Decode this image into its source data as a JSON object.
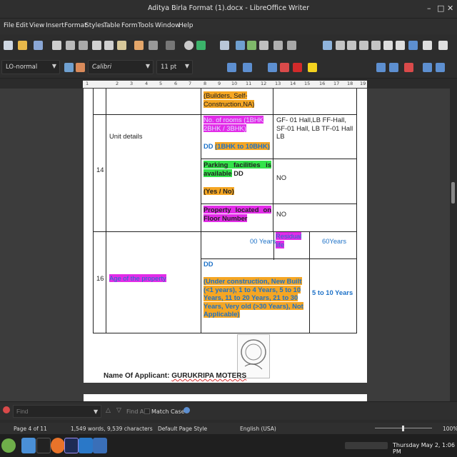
{
  "window": {
    "title": "Aditya Birla Format (1).docx - LibreOffice Writer",
    "minimize": "–",
    "maximize": "□",
    "close": "✕"
  },
  "menu": [
    "File",
    "Edit",
    "View",
    "Insert",
    "Format",
    "Styles",
    "Table",
    "Form",
    "Tools",
    "Window",
    "Help"
  ],
  "toolbar": {
    "paragraph_style": "LO-normal",
    "font_name": "Calibri",
    "font_size": "11 pt"
  },
  "ruler": [
    "1",
    "2",
    "3",
    "4",
    "5",
    "6",
    "7",
    "8",
    "9",
    "10",
    "11",
    "12",
    "13",
    "14",
    "15",
    "16",
    "17",
    "18",
    "19"
  ],
  "document": {
    "r0_col3": "(Builders, Self-Construction,NA)",
    "r14_no": "14",
    "r14_label": "Unit details",
    "r14_rooms_label": "No. of rooms (1BHK 2BHK / 3BHK)",
    "r14_rooms_dd": "DD",
    "r14_rooms_range": "(1BHK to 10BHK)",
    "r14_rooms_value": "GF- 01 Hall,LB FF-Hall, SF-01 Hall, LB TF-01 Hall LB",
    "r14_parking_label": "Parking facilities is available",
    "r14_parking_dd": "DD",
    "r14_parking_opts": "(Yes / No)",
    "r14_parking_value": "NO",
    "r14_floor_label": "Property located on Floor Number",
    "r14_floor_value": "NO",
    "r16_no": "16",
    "r16_label": "Age of the property",
    "r16_years": "00 Years",
    "r16_residual": "Residual life",
    "r16_residual_value": "60Years",
    "r16_dd": "DD",
    "r16_options": "(Under construction, New Built (<1 years), 1 to 4 Years, 5 to 10 Years, 11 to 20 Years, 21 to 30 Years, Very old (>30 Years), Not Applicable)",
    "r16_value": "5 to 10 Years",
    "applicant_label": "Name Of Applicant",
    "applicant_name": "GURUKRIPA MOTERS"
  },
  "findbar": {
    "placeholder": "Find",
    "find_all": "Find All",
    "match_case": "Match Case"
  },
  "status": {
    "page": "Page 4 of 11",
    "words": "1,549 words, 9,539 characters",
    "page_style": "Default Page Style",
    "language": "English (USA)",
    "zoom": "100%"
  },
  "taskbar": {
    "clock": "Thursday May 2, 1:06 PM"
  },
  "colors": {
    "highlight_orange": "#f5a623",
    "highlight_magenta": "#e22ce8",
    "highlight_green": "#34e34a",
    "text_blue": "#1e72c8"
  },
  "icons": [
    "new-document-icon",
    "open-folder-icon",
    "save-icon",
    "print-icon",
    "cut-icon",
    "copy-icon",
    "paste-icon",
    "undo-icon",
    "redo-icon",
    "table-icon",
    "image-icon",
    "chart-icon",
    "find-icon",
    "close-icon",
    "linux-mint-icon",
    "firefox-icon",
    "premiere-icon",
    "vscode-icon",
    "writer-icon"
  ]
}
